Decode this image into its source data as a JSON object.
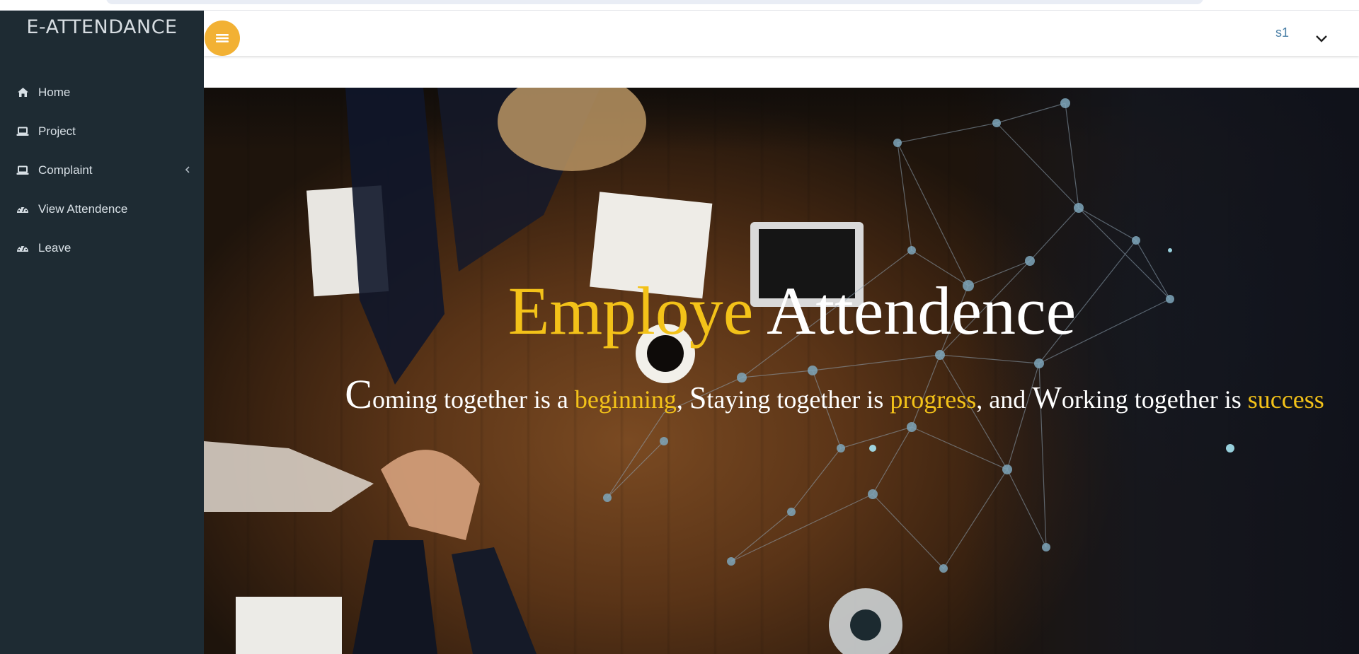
{
  "app": {
    "brand": "E-ATTENDANCE"
  },
  "sidebar": {
    "items": [
      {
        "label": "Home",
        "icon": "home-icon"
      },
      {
        "label": "Project",
        "icon": "laptop-icon"
      },
      {
        "label": "Complaint",
        "icon": "laptop-icon",
        "has_submenu": true
      },
      {
        "label": "View Attendence",
        "icon": "dashboard-icon"
      },
      {
        "label": "Leave",
        "icon": "dashboard-icon"
      }
    ]
  },
  "header": {
    "menu_icon": "hamburger-icon",
    "user_name": "s1",
    "user_dropdown_icon": "chevron-down-icon"
  },
  "hero": {
    "title_part1": "Employe",
    "title_part2": "Attendence",
    "subtitle": {
      "c_cap": "C",
      "c_rest": "oming together is a ",
      "word1": "beginning",
      "sep1": ", ",
      "s_cap": "S",
      "s_rest": "taying together is ",
      "word2": "progress",
      "sep2": ", and ",
      "w_cap": "W",
      "w_rest": "orking together is ",
      "word3": "success"
    }
  },
  "colors": {
    "sidebar_bg": "#1e2b33",
    "accent": "#f2b134",
    "gold_text": "#f3c219",
    "user_link": "#4a7fa6"
  }
}
